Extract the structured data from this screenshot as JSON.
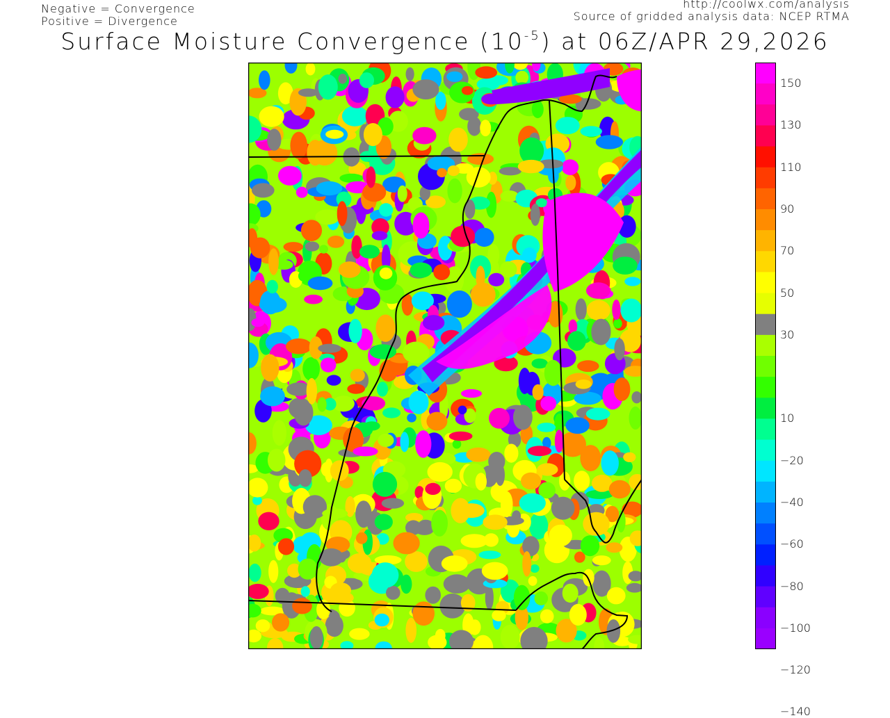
{
  "header": {
    "legend_line1": "Negative = Convergence",
    "legend_line2": "Positive = Divergence",
    "source_url": "http://coolwx.com/analysis",
    "source_line": "Source of gridded analysis data:  NCEP RTMA",
    "title_prefix": "Surface Moisture Convergence (10",
    "title_exponent": "-5",
    "title_suffix": ") at 06Z/APR 29,2026"
  },
  "colorbar": {
    "labels": [
      "150",
      "130",
      "110",
      "90",
      "70",
      "50",
      "30",
      "10",
      "−20",
      "−40",
      "−60",
      "−80",
      "−100",
      "−120",
      "−140"
    ],
    "colors": [
      "#ff00ff",
      "#ff00c8",
      "#ff0096",
      "#ff0050",
      "#ff1000",
      "#ff3c00",
      "#ff6400",
      "#ff8c00",
      "#ffb400",
      "#ffd800",
      "#ffff00",
      "#e6ff00",
      "#808080",
      "#aaff00",
      "#70ff00",
      "#33ff00",
      "#00ee40",
      "#00ff90",
      "#00ffd0",
      "#00e6ff",
      "#00b4ff",
      "#0080ff",
      "#0050ff",
      "#0020ff",
      "#3000ff",
      "#6000ff",
      "#8a00ff",
      "#9a00ff"
    ]
  }
}
